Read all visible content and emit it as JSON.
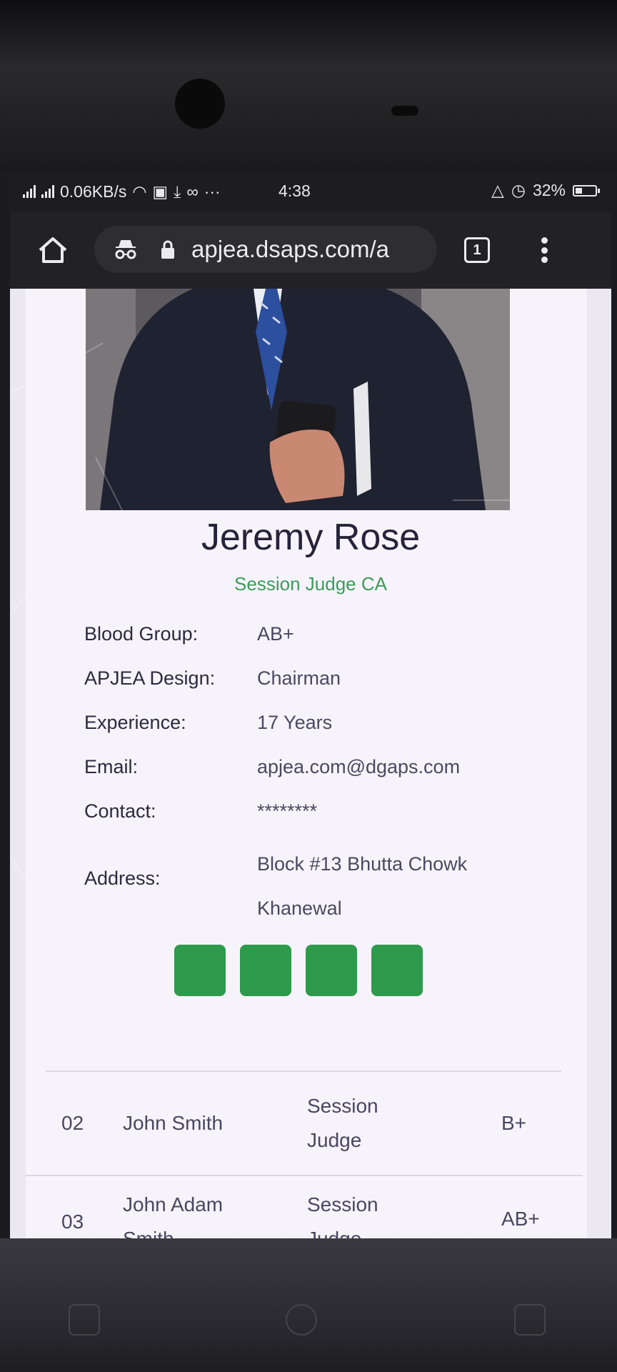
{
  "status_bar": {
    "network_speed": "0.06KB/s",
    "extra_dots": "···",
    "time": "4:38",
    "battery": "32%"
  },
  "browser": {
    "url": "apjea.dsaps.com/a",
    "tab_count": "1",
    "icons": [
      "home-icon",
      "incognito-icon",
      "lock-icon",
      "tab-switcher-icon",
      "overflow-menu-icon"
    ]
  },
  "profile": {
    "name": "Jeremy Rose",
    "role": "Session Judge CA",
    "details": [
      {
        "label": "Blood Group:",
        "value": "AB+"
      },
      {
        "label": "APJEA Design:",
        "value": "Chairman"
      },
      {
        "label": "Experience:",
        "value": "17 Years"
      },
      {
        "label": "Email:",
        "value": "apjea.com@dgaps.com"
      },
      {
        "label": "Contact:",
        "value": "********"
      },
      {
        "label": "Address:",
        "value": "Block #13 Bhutta Chowk Khanewal"
      }
    ],
    "social_buttons": 4
  },
  "members": [
    {
      "no": "02",
      "name": "John Smith",
      "post": "Session Judge",
      "blood": "B+"
    },
    {
      "no": "03",
      "name": "John Adam Smith",
      "post": "Session Judge",
      "blood": "AB+"
    }
  ],
  "scroll_top": {
    "icon": "arrow-up-icon",
    "glyph": "↑"
  },
  "colors": {
    "accent_green": "#2e9a4c",
    "role_green": "#3f9a5c"
  }
}
